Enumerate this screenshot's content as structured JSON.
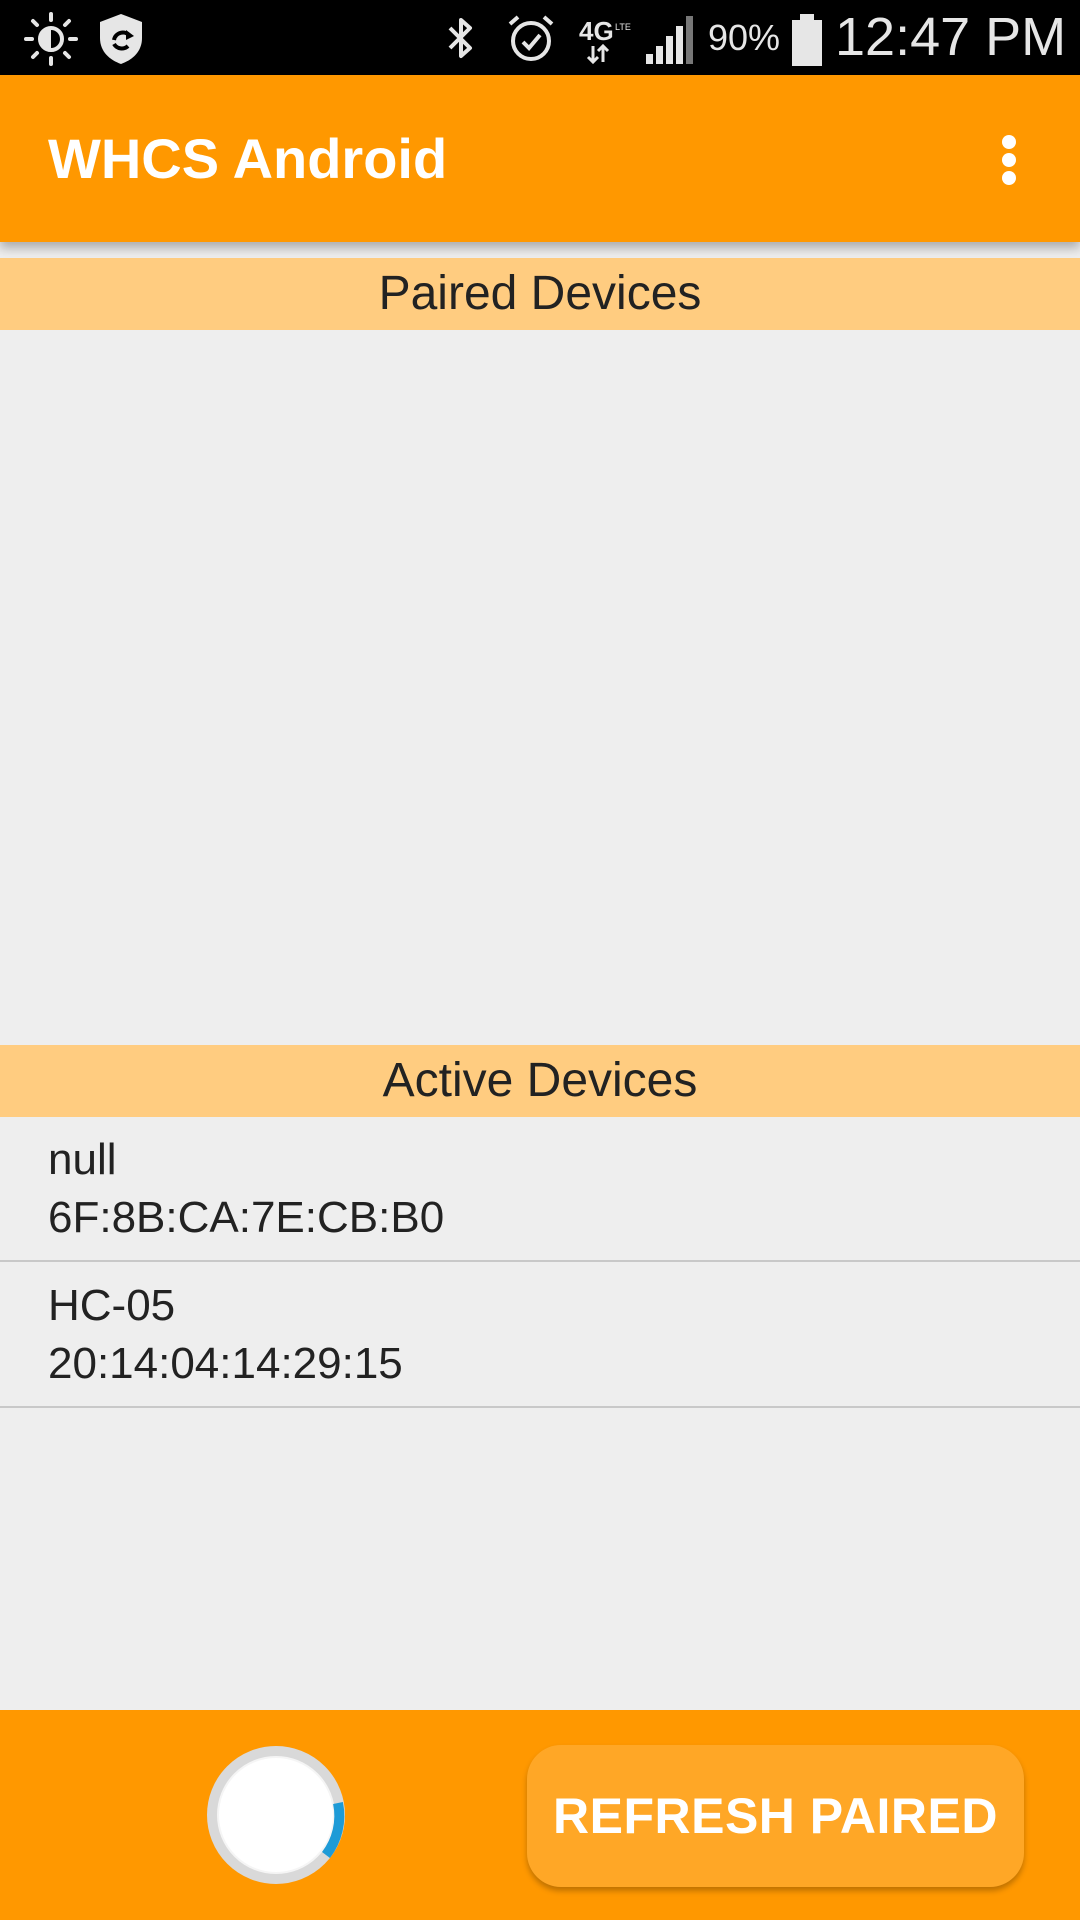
{
  "status_bar": {
    "icons": [
      "brightness-icon",
      "shield-sync-icon",
      "bluetooth-icon",
      "alarm-icon",
      "lte-4g-icon",
      "signal-icon",
      "battery-icon"
    ],
    "battery_percent": "90%",
    "time": "12:47 PM"
  },
  "app_bar": {
    "title": "WHCS Android",
    "menu_icon": "overflow-menu-icon"
  },
  "paired": {
    "header": "Paired Devices",
    "items": []
  },
  "active": {
    "header": "Active Devices",
    "items": [
      {
        "name": "null",
        "address": "6F:8B:CA:7E:CB:B0"
      },
      {
        "name": "HC-05",
        "address": "20:14:04:14:29:15"
      }
    ]
  },
  "bottom_bar": {
    "refresh_label": "REFRESH PAIRED",
    "spinner_icon": "progress-spinner-icon"
  },
  "colors": {
    "primary": "#ff9800",
    "header_bg": "#ffcc80",
    "background": "#eeeeee",
    "spinner_accent": "#1e9bd7"
  }
}
